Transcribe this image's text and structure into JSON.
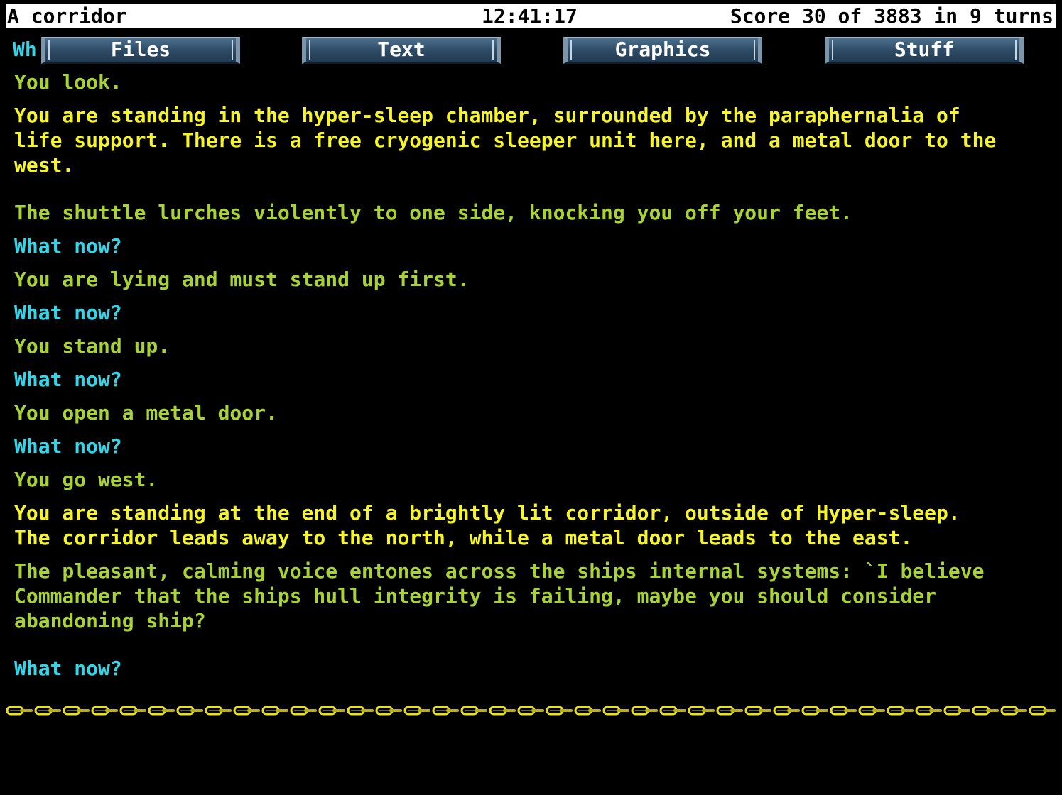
{
  "status": {
    "location": "A corridor",
    "clock": "12:41:17",
    "score": "Score 30 of 3883 in 9 turns"
  },
  "menu": {
    "partial_prompt": "Wh",
    "items": [
      "Files",
      "Text",
      "Graphics",
      "Stuff"
    ]
  },
  "transcript": [
    {
      "type": "response",
      "text": "You look."
    },
    {
      "type": "room",
      "text": "You are standing in the hyper-sleep chamber, surrounded by the paraphernalia of\nlife support. There is a free cryogenic sleeper unit here, and a metal door to the\nwest."
    },
    {
      "type": "response",
      "text": "The shuttle lurches violently to one side, knocking you off your feet."
    },
    {
      "type": "prompt",
      "text": "What now?"
    },
    {
      "type": "response",
      "text": "You are lying and must stand up first."
    },
    {
      "type": "prompt",
      "text": "What now?"
    },
    {
      "type": "response",
      "text": "You stand up."
    },
    {
      "type": "prompt",
      "text": "What now?"
    },
    {
      "type": "response",
      "text": "You open a metal door."
    },
    {
      "type": "prompt",
      "text": "What now?"
    },
    {
      "type": "response",
      "text": "You go west."
    },
    {
      "type": "room",
      "text": "You are standing at the end of a brightly lit corridor, outside of Hyper-sleep.\nThe corridor leads away to the north, while a metal door leads to the east."
    },
    {
      "type": "response",
      "text": "The pleasant, calming voice entones across the ships internal systems: `I believe\nCommander that the ships hull integrity is failing, maybe you should consider\nabandoning ship?"
    },
    {
      "type": "prompt",
      "text": "What now?"
    }
  ],
  "colors": {
    "response": "#a8d236",
    "room": "#f5f52a",
    "prompt": "#33d6e8",
    "background": "#000000",
    "statusbar": "#ffffff"
  },
  "icons": {
    "divider": "chain-divider"
  }
}
